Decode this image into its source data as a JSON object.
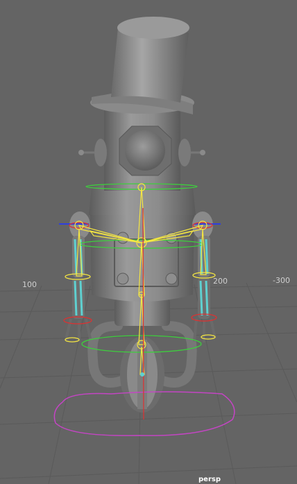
{
  "viewport": {
    "camera_label": "persp",
    "grid_labels": [
      "100",
      "200",
      "-300"
    ]
  },
  "colors": {
    "background": "#646464",
    "grid": "#5a5a5a",
    "model": "#8a8a8a",
    "joint": "#f5e642",
    "control_green": "#3dcf3d",
    "control_magenta": "#c445c4",
    "control_blue": "#2f3fe0",
    "control_red": "#e03030",
    "selection_cyan": "#5fd0d0"
  },
  "icons": [
    "character-rig-icon"
  ]
}
